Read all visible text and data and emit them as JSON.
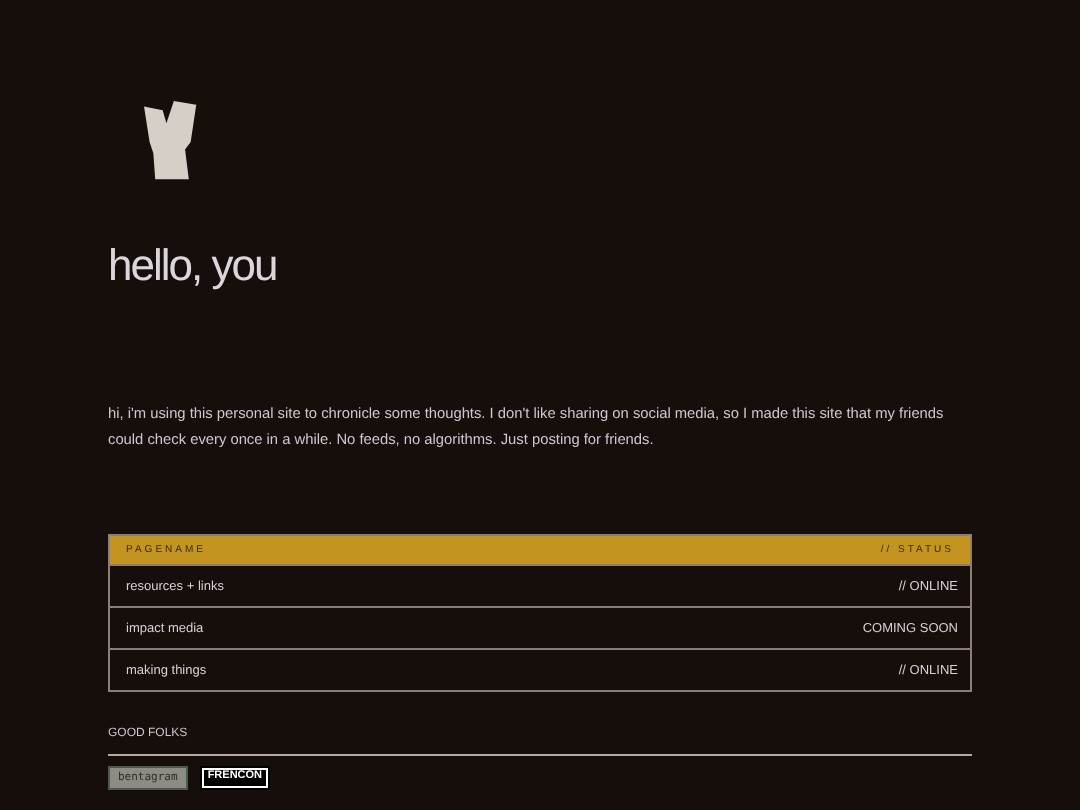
{
  "heading": "hello, you",
  "intro": "hi, i'm using this personal site to chronicle some thoughts. I don't like sharing on social media, so I made this site that my friends could check every once in a while. No feeds, no algorithms. Just posting for friends.",
  "table": {
    "columns": [
      "PAGENAME",
      "// STATUS"
    ],
    "rows": [
      {
        "page": "resources + links",
        "status": "// ONLINE"
      },
      {
        "page": "impact media",
        "status": "COMING SOON"
      },
      {
        "page": "making things",
        "status": "// ONLINE"
      }
    ]
  },
  "friends": {
    "title": "GOOD FOLKS",
    "badges": [
      {
        "label": "bentagram",
        "kind": "grey"
      },
      {
        "label": "FRENCON",
        "kind": "mono"
      }
    ]
  }
}
